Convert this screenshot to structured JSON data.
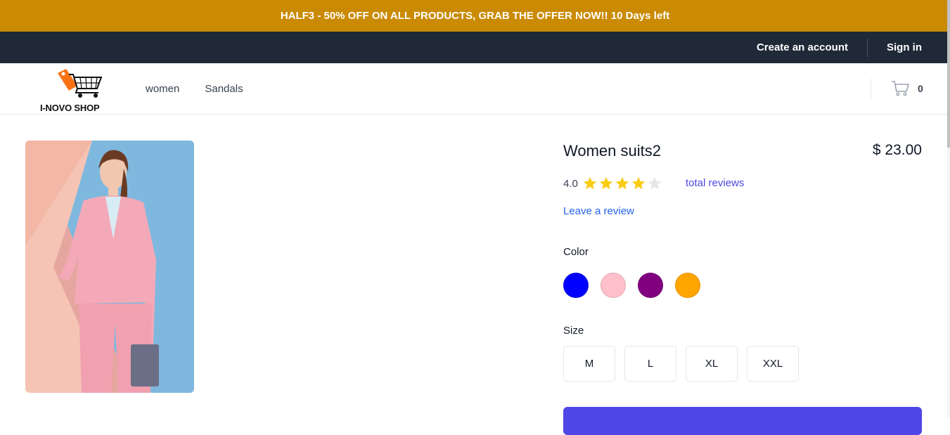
{
  "promo": {
    "text": "HALF3 - 50% OFF ON ALL PRODUCTS, GRAB THE OFFER NOW!! 10 Days left"
  },
  "topbar": {
    "create_account": "Create an account",
    "sign_in": "Sign in"
  },
  "nav": {
    "logo_text": "I-NOVO SHOP",
    "links": [
      "women",
      "Sandals"
    ],
    "cart_count": "0",
    "cart_icon": "cart-icon"
  },
  "product": {
    "title": "Women suits2",
    "price": "$ 23.00",
    "rating": "4.0",
    "rating_value": 4,
    "rating_max": 5,
    "total_reviews_label": "total reviews",
    "leave_review_label": "Leave a review",
    "color_label": "Color",
    "colors": [
      "#0000ff",
      "#ffc0cb",
      "#800080",
      "#ffa500"
    ],
    "size_label": "Size",
    "sizes": [
      "M",
      "L",
      "XL",
      "XXL"
    ]
  },
  "theme": {
    "promo_bg": "#ca8a04",
    "topbar_bg": "#1f2937",
    "accent": "#4f46e5",
    "star_color": "#facc15"
  }
}
